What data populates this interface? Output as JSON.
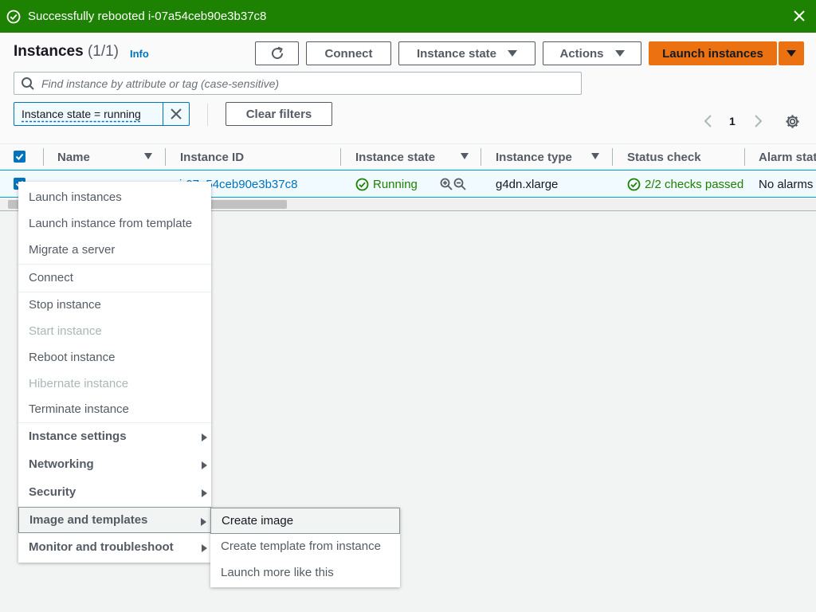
{
  "banner": {
    "message": "Successfully rebooted i-07a54ceb90e3b37c8",
    "color": "#1d8102"
  },
  "header": {
    "title": "Instances",
    "count": "(1/1)",
    "info_link": "Info"
  },
  "toolbar": {
    "connect": "Connect",
    "instance_state": "Instance state",
    "actions": "Actions",
    "launch": "Launch instances"
  },
  "search": {
    "placeholder": "Find instance by attribute or tag (case-sensitive)"
  },
  "filter": {
    "token": "Instance state = running",
    "clear": "Clear filters"
  },
  "pagination": {
    "page": "1"
  },
  "table": {
    "columns": [
      "Name",
      "Instance ID",
      "Instance state",
      "Instance type",
      "Status check",
      "Alarm stat"
    ],
    "row": {
      "instance_id": "i-07a54ceb90e3b37c8",
      "instance_state": "Running",
      "instance_type": "g4dn.xlarge",
      "status_check": "2/2 checks passed",
      "alarm_status": "No alarms"
    }
  },
  "context_menu": {
    "items": [
      "Launch instances",
      "Launch instance from template",
      "Migrate a server",
      "Connect",
      "Stop instance",
      "Start instance",
      "Reboot instance",
      "Hibernate instance",
      "Terminate instance",
      "Instance settings",
      "Networking",
      "Security",
      "Image and templates",
      "Monitor and troubleshoot"
    ]
  },
  "submenu": {
    "items": [
      "Create image",
      "Create template from instance",
      "Launch more like this"
    ]
  },
  "colors": {
    "primary": "#ec7211",
    "link": "#0073bb",
    "success": "#1d8102"
  }
}
